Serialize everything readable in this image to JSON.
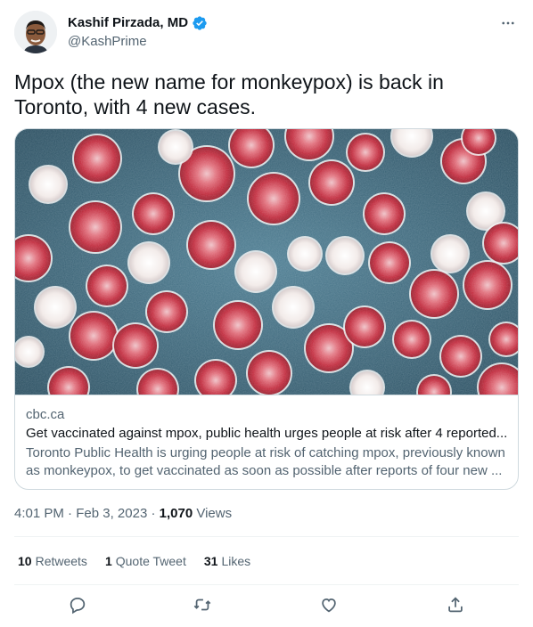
{
  "author": {
    "display_name": "Kashif Pirzada, MD",
    "handle": "@KashPrime",
    "verified": true
  },
  "tweet": {
    "text": "Mpox (the new name for monkeypox) is back in Toronto, with 4 new cases."
  },
  "link_card": {
    "domain": "cbc.ca",
    "title": "Get vaccinated against mpox, public health urges people at risk after 4 reported...",
    "description": "Toronto Public Health is urging people at risk of catching mpox, previously known as monkeypox, to get vaccinated as soon as possible after reports of four new ..."
  },
  "meta": {
    "time": "4:01 PM",
    "date": "Feb 3, 2023",
    "views_count": "1,070",
    "views_label": "Views",
    "separator": "·"
  },
  "stats": {
    "retweets_count": "10",
    "retweets_label": "Retweets",
    "quotes_count": "1",
    "quotes_label": "Quote Tweet",
    "likes_count": "31",
    "likes_label": "Likes"
  },
  "actions": [
    "reply-icon",
    "retweet-icon",
    "like-icon",
    "share-icon"
  ],
  "colors": {
    "verified_blue": "#1d9bf0",
    "secondary_text": "#536471",
    "primary_text": "#0f1419",
    "border": "#cfd9de"
  }
}
